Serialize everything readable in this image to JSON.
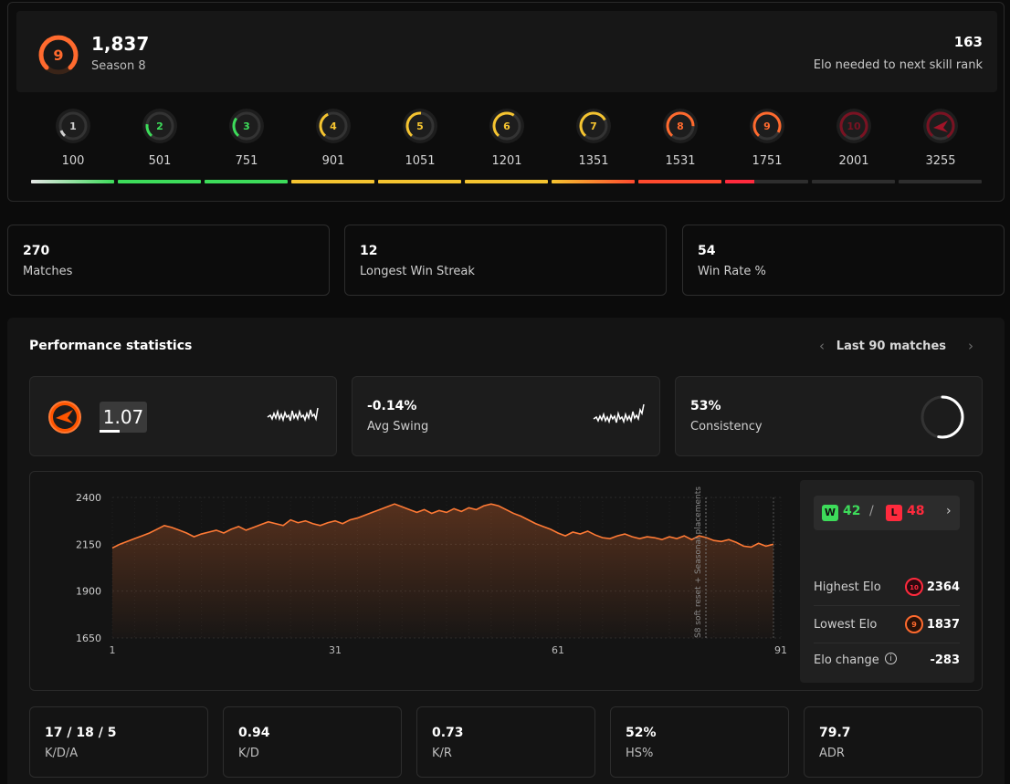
{
  "skill": {
    "current_level": "9",
    "elo": "1,837",
    "season": "Season 8",
    "elo_needed": "163",
    "elo_needed_label": "Elo needed to next skill rank",
    "levels": [
      {
        "label": "1",
        "elo": "100",
        "color": "#d0d0d0"
      },
      {
        "label": "2",
        "elo": "501",
        "color": "#3ddc5a"
      },
      {
        "label": "3",
        "elo": "751",
        "color": "#3ddc5a"
      },
      {
        "label": "4",
        "elo": "901",
        "color": "#f5c430"
      },
      {
        "label": "5",
        "elo": "1051",
        "color": "#f5c430"
      },
      {
        "label": "6",
        "elo": "1201",
        "color": "#f5c430"
      },
      {
        "label": "7",
        "elo": "1351",
        "color": "#f5c430"
      },
      {
        "label": "8",
        "elo": "1531",
        "color": "#ff6a2e"
      },
      {
        "label": "9",
        "elo": "1751",
        "color": "#ff6a2e"
      },
      {
        "label": "10",
        "elo": "2001",
        "color": "#7a1222"
      },
      {
        "label": "",
        "elo": "3255",
        "color": "#7a1222"
      }
    ]
  },
  "stats": [
    {
      "value": "270",
      "label": "Matches"
    },
    {
      "value": "12",
      "label": "Longest Win Streak"
    },
    {
      "value": "54",
      "label": "Win Rate %"
    }
  ],
  "performance": {
    "title": "Performance statistics",
    "range": "Last 90 matches",
    "kd_value": "1.07",
    "swing_value": "-0.14%",
    "swing_label": "Avg Swing",
    "consistency_value": "53%",
    "consistency_label": "Consistency",
    "consistency_fraction": 0.53
  },
  "winloss": {
    "w_label": "W",
    "wins": "42",
    "l_label": "L",
    "losses": "48",
    "separator": "/",
    "highest_label": "Highest Elo",
    "highest_badge": "10",
    "highest": "2364",
    "lowest_label": "Lowest Elo",
    "lowest_badge": "9",
    "lowest": "1837",
    "change_label": "Elo change",
    "change": "-283"
  },
  "chart_data": {
    "type": "area",
    "ylim": [
      1650,
      2400
    ],
    "xlim": [
      1,
      91
    ],
    "yticks": [
      "2400",
      "2150",
      "1900",
      "1650"
    ],
    "xticks": [
      "1",
      "31",
      "61",
      "91"
    ],
    "annotation": "S8 soft reset + Seasonal placements",
    "color": "#ff7a35",
    "values": [
      2130,
      2150,
      2165,
      2180,
      2195,
      2210,
      2230,
      2250,
      2240,
      2225,
      2210,
      2190,
      2205,
      2215,
      2225,
      2210,
      2230,
      2245,
      2225,
      2240,
      2255,
      2270,
      2260,
      2250,
      2280,
      2265,
      2275,
      2260,
      2250,
      2265,
      2275,
      2260,
      2280,
      2290,
      2305,
      2320,
      2335,
      2350,
      2365,
      2350,
      2335,
      2320,
      2335,
      2315,
      2330,
      2320,
      2340,
      2325,
      2345,
      2335,
      2355,
      2365,
      2355,
      2335,
      2315,
      2300,
      2280,
      2260,
      2245,
      2230,
      2210,
      2195,
      2215,
      2205,
      2220,
      2200,
      2185,
      2180,
      2195,
      2205,
      2190,
      2180,
      2190,
      2185,
      2175,
      2190,
      2180,
      2195,
      2175,
      2195,
      2185,
      2170,
      2165,
      2175,
      2160,
      2140,
      2135,
      2155,
      2140,
      2150
    ]
  },
  "bottom_stats": [
    {
      "value": "17 / 18 / 5",
      "label": "K/D/A"
    },
    {
      "value": "0.94",
      "label": "K/D"
    },
    {
      "value": "0.73",
      "label": "K/R"
    },
    {
      "value": "52%",
      "label": "HS%"
    },
    {
      "value": "79.7",
      "label": "ADR"
    }
  ]
}
